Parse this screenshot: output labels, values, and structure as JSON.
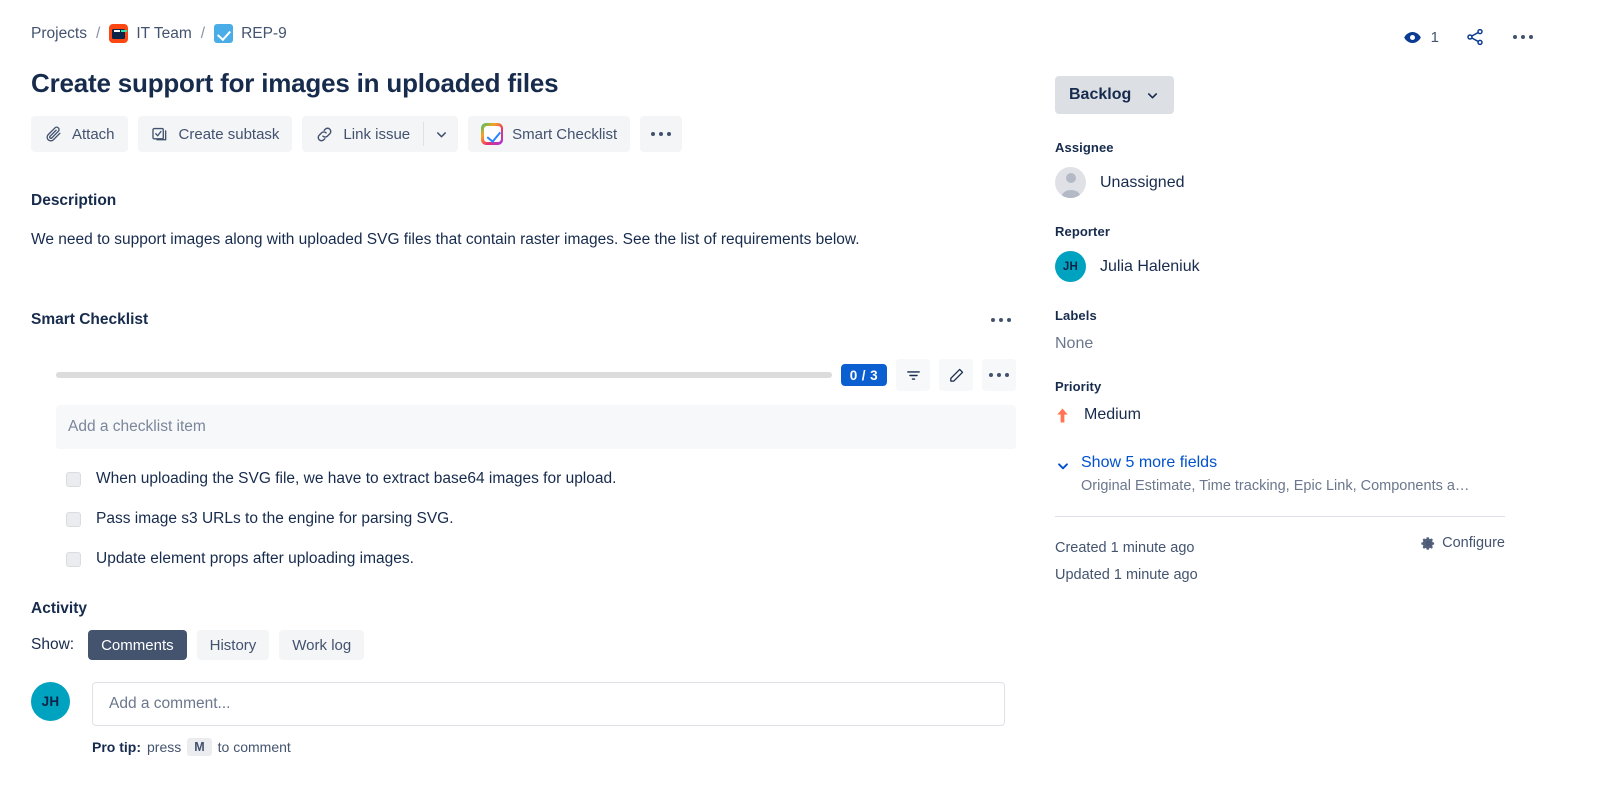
{
  "breadcrumb": {
    "projects_label": "Projects",
    "separator": "/",
    "project_name": "IT Team",
    "issue_key": "REP-9"
  },
  "header": {
    "watch_count": "1",
    "watch_icon": "eye-icon",
    "share_icon": "share-icon",
    "more_icon": "more-horizontal-icon"
  },
  "issue": {
    "title": "Create support for images in uploaded files"
  },
  "actions": {
    "attach": "Attach",
    "create_subtask": "Create subtask",
    "link_issue": "Link issue",
    "smart_checklist": "Smart Checklist",
    "attach_icon": "paperclip-icon",
    "subtask_icon": "subtask-icon",
    "link_icon": "link-icon",
    "caret_icon": "chevron-down-icon",
    "more_icon": "more-horizontal-icon"
  },
  "description": {
    "heading": "Description",
    "body": "We need to support images along with uploaded SVG files that contain raster images. See the list of requirements below."
  },
  "checklist": {
    "heading": "Smart Checklist",
    "progress_badge": "0 / 3",
    "progress_percent": 0,
    "add_placeholder": "Add a checklist item",
    "filter_icon": "filter-icon",
    "edit_icon": "pencil-icon",
    "more_icon": "more-horizontal-icon",
    "items": [
      {
        "label": "When uploading the SVG file, we have to extract base64 images for upload.",
        "checked": false
      },
      {
        "label": "Pass image s3 URLs to the engine for parsing SVG.",
        "checked": false
      },
      {
        "label": "Update element props after uploading images.",
        "checked": false
      }
    ]
  },
  "activity": {
    "heading": "Activity",
    "show_label": "Show:",
    "tabs": [
      {
        "label": "Comments",
        "selected": true
      },
      {
        "label": "History",
        "selected": false
      },
      {
        "label": "Work log",
        "selected": false
      }
    ],
    "comment_avatar": "JH",
    "comment_placeholder": "Add a comment...",
    "protip_prefix": "Pro tip:",
    "protip_press": "press",
    "protip_key": "M",
    "protip_suffix": "to comment"
  },
  "sidebar": {
    "status": "Backlog",
    "status_caret_icon": "chevron-down-icon",
    "assignee_label": "Assignee",
    "assignee_value": "Unassigned",
    "assignee_avatar_icon": "person-avatar-icon",
    "reporter_label": "Reporter",
    "reporter_value": "Julia Haleniuk",
    "reporter_initials": "JH",
    "labels_label": "Labels",
    "labels_value": "None",
    "priority_label": "Priority",
    "priority_value": "Medium",
    "priority_icon": "arrow-up-icon",
    "show_more_label": "Show 5 more fields",
    "show_more_sub": "Original Estimate, Time tracking, Epic Link, Components a…",
    "show_more_icon": "chevron-down-icon",
    "created": "Created 1 minute ago",
    "updated": "Updated 1 minute ago",
    "configure": "Configure",
    "configure_icon": "gear-icon"
  },
  "colors": {
    "accent_blue": "#0052CC",
    "badge_blue": "#0B5FD0",
    "avatar_teal": "#00A3BF",
    "priority_orange": "#FF7452",
    "project_orange": "#FF4713",
    "task_blue": "#4BADE8",
    "tab_selected": "#44546F"
  }
}
